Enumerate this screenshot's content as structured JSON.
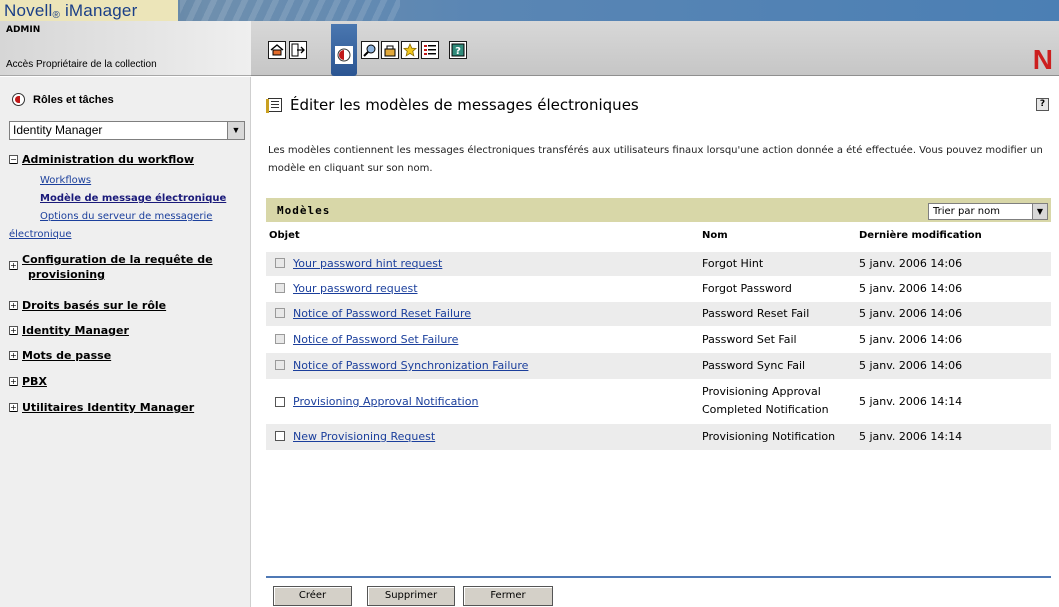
{
  "header": {
    "brand": "Novell",
    "brand_mark": "®",
    "brand_product": " iManager",
    "user": "ADMIN",
    "role_desc": "Accès Propriétaire de la collection",
    "logo_letter": "N"
  },
  "toolbar": {
    "tools": [
      "home-icon",
      "exit-icon",
      "roles-tasks-icon",
      "view-objects-icon",
      "configure-icon",
      "favorites-icon",
      "preferences-icon",
      "help-icon"
    ]
  },
  "sidebar": {
    "title": "Rôles et tâches",
    "select_value": "Identity Manager",
    "groups": [
      {
        "label": "Administration du workflow",
        "expanded": true
      },
      {
        "label_line1": "Configuration de la requête de",
        "label_line2": "provisioning",
        "expanded": false
      },
      {
        "label": "Droits basés sur le rôle",
        "expanded": false
      },
      {
        "label": "Identity Manager",
        "expanded": false
      },
      {
        "label": "Mots de passe",
        "expanded": false
      },
      {
        "label": "PBX",
        "expanded": false
      },
      {
        "label": "Utilitaires Identity Manager",
        "expanded": false
      }
    ],
    "subitems": {
      "workflows": "Workflows",
      "email_template": "Modèle de message électronique",
      "mail_options_line1": "Options du serveur de messagerie",
      "mail_options_line2": "électronique"
    },
    "expand_glyph_minus": "−",
    "expand_glyph_plus": "+"
  },
  "main": {
    "title": "Éditer les modèles de messages électroniques",
    "help": "?",
    "intro": "Les modèles contiennent les messages électroniques transférés aux utilisateurs finaux lorsqu'une action donnée a été effectuée. Vous pouvez modifier un modèle en cliquant sur son nom.",
    "models_label": "Modèles",
    "sort_value": "Trier par nom",
    "columns": {
      "object": "Objet",
      "name": "Nom",
      "modified": "Dernière modification"
    },
    "rows": [
      {
        "object": "Your password hint request",
        "name": "Forgot Hint",
        "modified": "5 janv. 2006 14:06"
      },
      {
        "object": "Your password request",
        "name": "Forgot Password",
        "modified": "5 janv. 2006 14:06"
      },
      {
        "object": "Notice of Password Reset Failure",
        "name": "Password Reset Fail",
        "modified": "5 janv. 2006 14:06"
      },
      {
        "object": "Notice of Password Set Failure",
        "name": "Password Set Fail",
        "modified": "5 janv. 2006 14:06"
      },
      {
        "object": "Notice of Password Synchronization Failure",
        "name": "Password Sync Fail",
        "modified": "5 janv. 2006 14:06"
      },
      {
        "object": "Provisioning Approval Notification",
        "name_line1": "Provisioning Approval",
        "name_line2": "Completed Notification",
        "modified": "5 janv. 2006 14:14"
      },
      {
        "object": "New Provisioning Request",
        "name": "Provisioning Notification",
        "modified": "5 janv. 2006 14:14"
      }
    ],
    "buttons": {
      "create": "Créer",
      "delete": "Supprimer",
      "close": "Fermer"
    }
  }
}
